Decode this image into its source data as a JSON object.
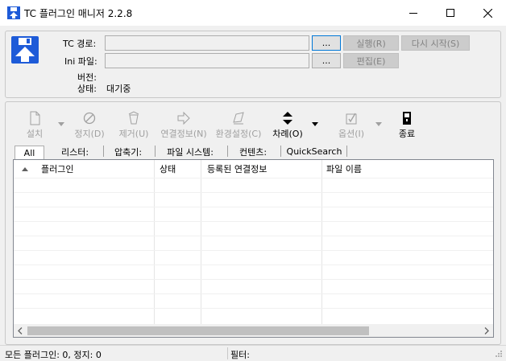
{
  "window": {
    "title": "TC 플러그인 매니저 2.2.8",
    "minimize_icon": "minimize-icon",
    "maximize_icon": "maximize-icon",
    "close_icon": "close-icon"
  },
  "info": {
    "tc_path_label": "TC 경로:",
    "tc_path_value": "",
    "browse_label": "...",
    "run_label": "실행(R)",
    "restart_label": "다시 시작(S)",
    "ini_label": "Ini 파일:",
    "ini_value": "",
    "browse2_label": "...",
    "edit_label": "편집(E)",
    "version_label": "버전:",
    "version_value": "",
    "status_label": "상태:",
    "status_value": "대기중"
  },
  "toolbar": {
    "install": "설치",
    "stop": "정지(D)",
    "remove": "제거(U)",
    "assoc_info": "연결정보(N)",
    "env_settings": "환경설정(C)",
    "order": "차례(O)",
    "options": "옵션(I)",
    "exit": "종료"
  },
  "tabs": [
    "All",
    "리스터:",
    "압축기:",
    "파일 시스템:",
    "컨텐츠:",
    "QuickSearch"
  ],
  "list": {
    "columns": [
      "플러그인",
      "상태",
      "등록된 연결정보",
      "파일 이름"
    ],
    "rows": []
  },
  "statusbar": {
    "count_text": "모든 플러그인: 0, 정지: 0",
    "filter_label": "필터:"
  },
  "colors": {
    "accent_blue": "#1e5bd8",
    "primary_border": "#0078d7",
    "disabled_text": "#838383"
  }
}
